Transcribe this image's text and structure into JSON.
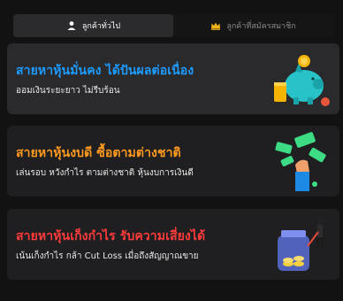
{
  "tabs": [
    {
      "label": "ลูกค้าทั่วไป",
      "icon": "user-icon",
      "active": true
    },
    {
      "label": "ลูกค้าที่สมัครสมาชิก",
      "icon": "crown-icon",
      "active": false
    }
  ],
  "cards": [
    {
      "title": "สายหาหุ้นมั่นคง ได้ปันผลต่อเนื่อง",
      "subtitle": "ออมเงินระยะยาว ไม่รีบร้อน",
      "title_color": "#1e9bff",
      "icon": "piggy-bank-icon"
    },
    {
      "title": "สายหาหุ้นงบดี ซื้อตามต่างชาติ",
      "subtitle": "เล่นรอบ หวังกำไร ตามต่างชาติ หุ้นงบการเงินดี",
      "title_color": "#ff9a1f",
      "icon": "money-hand-icon"
    },
    {
      "title": "สายหาหุ้นเก็งกำไร รับความเสี่ยงได้",
      "subtitle": "เน้นเก็งกำไร กล้า Cut Loss เมื่อถึงสัญญาณขาย",
      "title_color": "#ff3b3b",
      "icon": "coin-jar-icon"
    }
  ]
}
